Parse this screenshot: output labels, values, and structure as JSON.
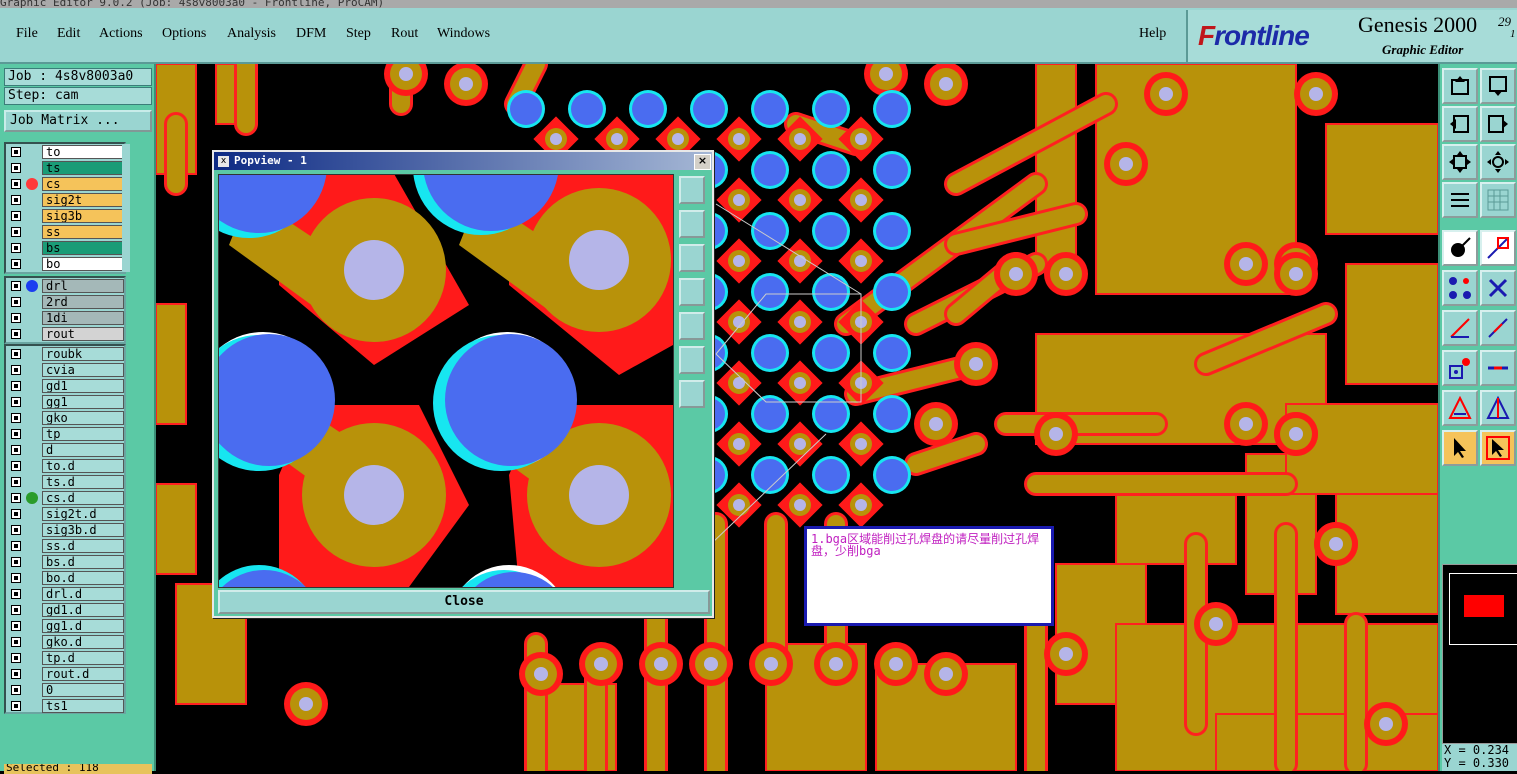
{
  "title_fragment": "Graphic Editor 9.0.2 (Job: 4s8v8003a0 - Frontline, ProCAM)",
  "menu": [
    "File",
    "Edit",
    "Actions",
    "Options",
    "Analysis",
    "DFM",
    "Step",
    "Rout",
    "Windows"
  ],
  "help": "Help",
  "brand": {
    "logo_rest": "rontline",
    "logo_f": "F",
    "product": "Genesis 2000",
    "subtitle": "Graphic Editor",
    "ver1": "29",
    "ver2": "1"
  },
  "job": "Job : 4s8v8003a0",
  "step": "Step: cam",
  "job_matrix": "Job Matrix ...",
  "layers_group1": [
    {
      "name": "to",
      "color": "#ffffff"
    },
    {
      "name": "ts",
      "color": "#1a9c77"
    },
    {
      "name": "cs",
      "color": "#f5c35a"
    },
    {
      "name": "sig2t",
      "color": "#f5c35a"
    },
    {
      "name": "sig3b",
      "color": "#f5c35a"
    },
    {
      "name": "ss",
      "color": "#f5c35a"
    },
    {
      "name": "bs",
      "color": "#1a9c77"
    },
    {
      "name": "bo",
      "color": "#ffffff"
    }
  ],
  "layers_group2": [
    {
      "name": "drl",
      "color": "#a4b8b8"
    },
    {
      "name": "2rd",
      "color": "#a4b8b8"
    },
    {
      "name": "1di",
      "color": "#a4b8b8"
    },
    {
      "name": "rout",
      "color": "#d3d3d3"
    }
  ],
  "layers_group3": [
    "roubk",
    "cvia",
    "gd1",
    "gg1",
    "gko",
    "tp",
    "d",
    "to.d",
    "ts.d",
    "cs.d",
    "sig2t.d",
    "sig3b.d",
    "ss.d",
    "bs.d",
    "bo.d",
    "drl.d",
    "gd1.d",
    "gg1.d",
    "gko.d",
    "tp.d",
    "rout.d",
    "0",
    "ts1"
  ],
  "selected": "Selected : 118",
  "popview": {
    "title": "Popview - 1",
    "close": "Close"
  },
  "note": "1.bga区域能削过孔焊盘的请尽量削过孔焊盘，少削bga",
  "coords": {
    "x": "X = 0.234",
    "y": "Y = 0.330"
  },
  "colors": {
    "copper": "#b8920a",
    "pad_red": "#ff1a1a",
    "via_blue": "#4a6cf0",
    "via_cyan": "#17e6f0",
    "drill": "#b5b5e8",
    "panel": "#5bc9a5",
    "menu": "#9ad5d1"
  }
}
